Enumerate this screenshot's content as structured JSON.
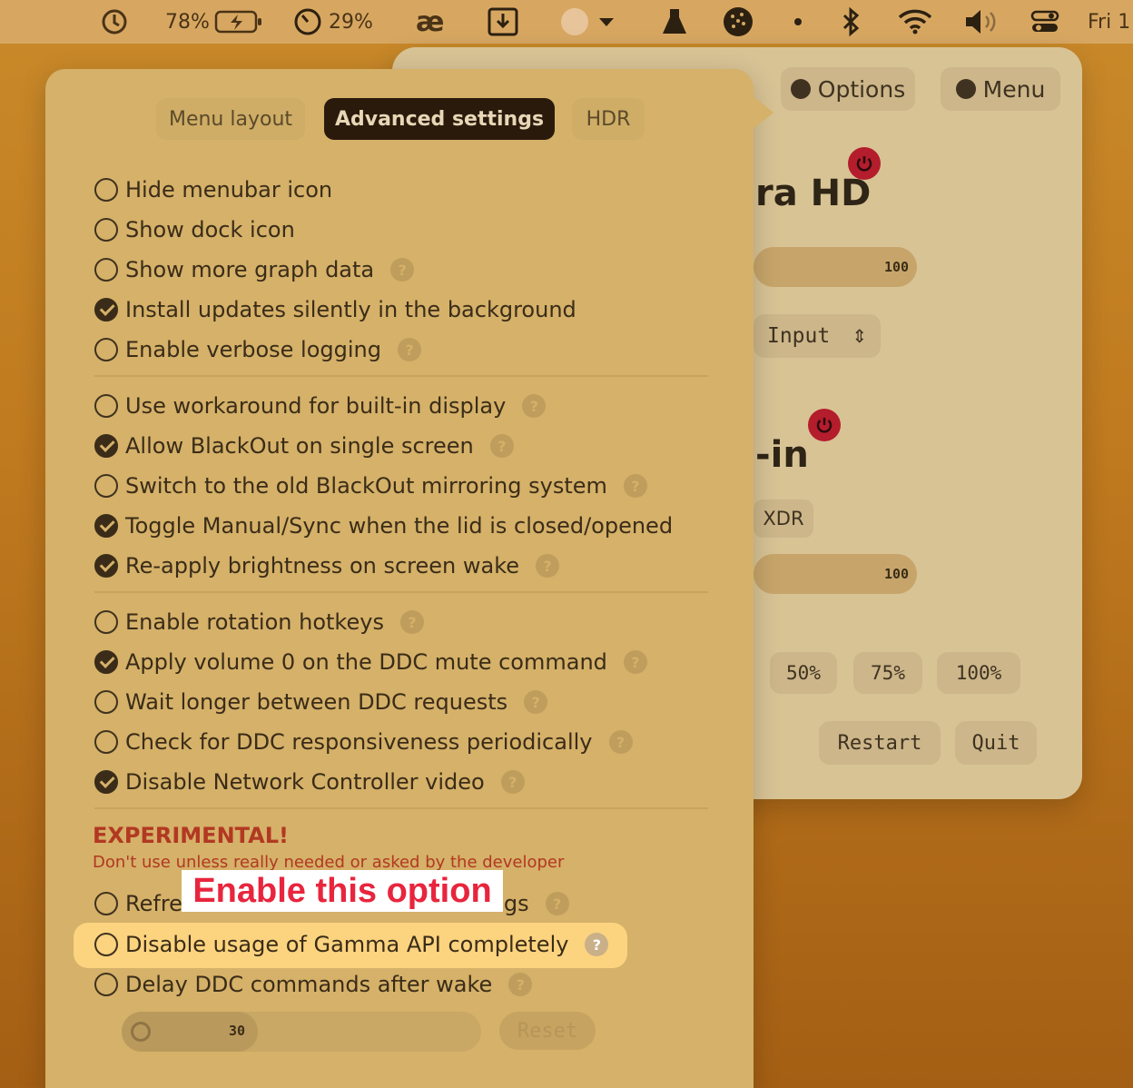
{
  "menubar": {
    "battery_percent": "78%",
    "timer_percent": "29%",
    "clock": "Fri 1"
  },
  "lunar": {
    "options_label": "Options",
    "menu_label": "Menu",
    "display1_name": "ra HD",
    "display1_value": "100",
    "input_label": "Input",
    "display2_name": "-in",
    "xdr_label": "XDR",
    "display2_value": "100",
    "presets": [
      "50%",
      "75%",
      "100%"
    ],
    "restart_label": "Restart",
    "quit_label": "Quit"
  },
  "tabs": {
    "menu_layout": "Menu layout",
    "advanced": "Advanced settings",
    "hdr": "HDR"
  },
  "settings": [
    {
      "label": "Hide menubar icon",
      "checked": false,
      "help": false
    },
    {
      "label": "Show dock icon",
      "checked": false,
      "help": false
    },
    {
      "label": "Show more graph data",
      "checked": false,
      "help": true
    },
    {
      "label": "Install updates silently in the background",
      "checked": true,
      "help": false
    },
    {
      "label": "Enable verbose logging",
      "checked": false,
      "help": true
    },
    {
      "label": "Use workaround for built-in display",
      "checked": false,
      "help": true
    },
    {
      "label": "Allow BlackOut on single screen",
      "checked": true,
      "help": true
    },
    {
      "label": "Switch to the old BlackOut mirroring system",
      "checked": false,
      "help": true
    },
    {
      "label": "Toggle Manual/Sync when the lid is closed/opened",
      "checked": true,
      "help": false
    },
    {
      "label": "Re-apply brightness on screen wake",
      "checked": true,
      "help": true
    },
    {
      "label": "Enable rotation hotkeys",
      "checked": false,
      "help": true
    },
    {
      "label": "Apply volume 0 on the DDC mute command",
      "checked": true,
      "help": true
    },
    {
      "label": "Wait longer between DDC requests",
      "checked": false,
      "help": true
    },
    {
      "label": "Check for DDC responsiveness periodically",
      "checked": false,
      "help": true
    },
    {
      "label": "Disable Network Controller video",
      "checked": true,
      "help": true
    }
  ],
  "experimental": {
    "title": "EXPERIMENTAL!",
    "subtitle": "Don't use unless really needed or asked by the developer",
    "items": [
      {
        "label": "Refresh values from monitor settings",
        "checked": false,
        "help": true
      },
      {
        "label": "Disable usage of Gamma API completely",
        "checked": false,
        "help": true
      },
      {
        "label": "Delay DDC commands after wake",
        "checked": false,
        "help": true
      }
    ],
    "delay_value": "30",
    "reset_label": "Reset"
  },
  "callout": "Enable this option",
  "help_glyph": "?"
}
